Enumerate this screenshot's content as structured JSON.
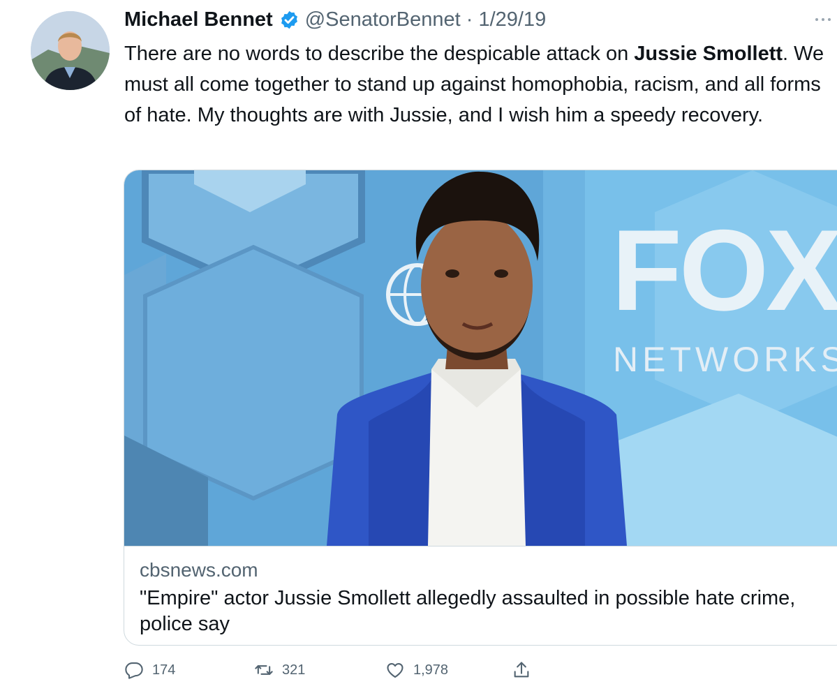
{
  "tweet": {
    "author_name": "Michael Bennet",
    "handle": "@SenatorBennet",
    "separator": " · ",
    "date": "1/29/19",
    "text_part1": "There are no words to describe the despicable attack on ",
    "text_bold": "Jussie Smollett",
    "text_part2": ". We must all come together to stand up against homophobia, racism, and all forms of hate. My thoughts are with Jussie, and I wish him a speedy recovery."
  },
  "card": {
    "domain": "cbsnews.com",
    "title": "\"Empire\" actor Jussie Smollett allegedly assaulted in possible hate crime, police say",
    "backdrop_logo": "FOX",
    "backdrop_sub": "NETWORKS"
  },
  "actions": {
    "reply_count": "174",
    "retweet_count": "321",
    "like_count": "1,978"
  },
  "icons": {
    "verified": "verified-badge-icon",
    "more": "more-options-icon",
    "reply": "reply-icon",
    "retweet": "retweet-icon",
    "like": "heart-icon",
    "share": "share-icon"
  },
  "colors": {
    "text": "#0f1419",
    "secondary": "#536471",
    "verified": "#1d9bf0",
    "border": "#cfd9de"
  }
}
